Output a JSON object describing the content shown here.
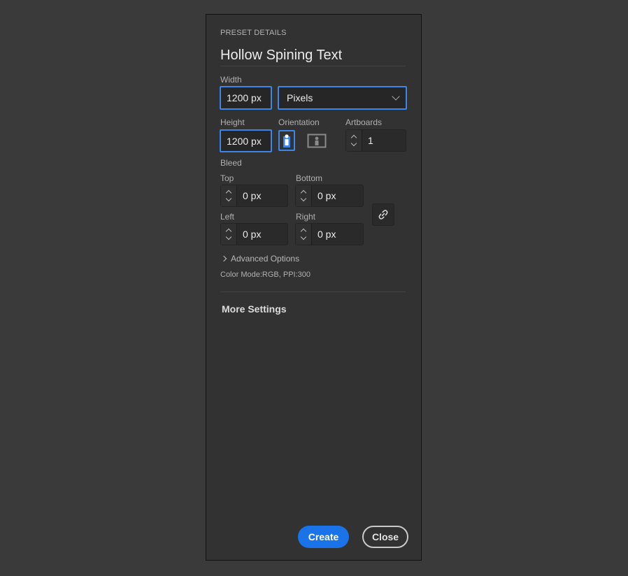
{
  "preset": {
    "section_label": "PRESET DETAILS",
    "name": "Hollow Spining Text"
  },
  "width": {
    "label": "Width",
    "value": "1200 px",
    "unit_selected": "Pixels"
  },
  "height": {
    "label": "Height",
    "value": "1200 px"
  },
  "orientation": {
    "label": "Orientation",
    "selected": "portrait",
    "icons": [
      "portrait-icon",
      "landscape-icon"
    ]
  },
  "artboards": {
    "label": "Artboards",
    "value": "1"
  },
  "bleed": {
    "label": "Bleed",
    "top_label": "Top",
    "top_value": "0 px",
    "bottom_label": "Bottom",
    "bottom_value": "0 px",
    "left_label": "Left",
    "left_value": "0 px",
    "right_label": "Right",
    "right_value": "0 px",
    "link_icon": "link-icon"
  },
  "advanced": {
    "label": "Advanced Options",
    "color_info": "Color Mode:RGB, PPI:300"
  },
  "more_settings": "More Settings",
  "buttons": {
    "create": "Create",
    "close": "Close"
  },
  "colors": {
    "accent": "#3d86e8",
    "primary_button": "#1a73e8",
    "panel_bg": "#323232",
    "page_bg": "#3a3a3a"
  }
}
